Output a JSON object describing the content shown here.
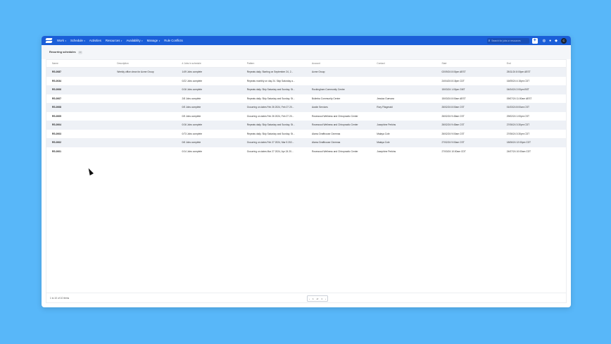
{
  "nav": {
    "items": [
      {
        "label": "Work",
        "dropdown": true
      },
      {
        "label": "Schedule",
        "dropdown": true
      },
      {
        "label": "Activities",
        "dropdown": false
      },
      {
        "label": "Resources",
        "dropdown": true
      },
      {
        "label": "Availability",
        "dropdown": true
      },
      {
        "label": "Manage",
        "dropdown": true
      },
      {
        "label": "Rule Conflicts",
        "dropdown": false
      }
    ],
    "search_placeholder": "Search for jobs or resources",
    "plus_label": "+",
    "avatar_initial": "C"
  },
  "page": {
    "title": "Recurring schedules",
    "count": "10"
  },
  "table": {
    "columns": [
      "Name",
      "Description",
      "# Jobs in schedule",
      "Pattern",
      "Account",
      "Contact",
      "Start",
      "End"
    ],
    "rows": [
      [
        "RS-0087",
        "Weekly office clean for Acme Group",
        "1/49 Jobs complete",
        "Repeats daily. Starting on September 24, 2...",
        "Acme Group",
        "",
        "02/09/24 8:00pm AEST",
        "25/11/24 8:00pm AEST"
      ],
      [
        "RS-0034",
        "",
        "0/22 Jobs complete",
        "Repeats monthly on day 24. Skip Saturday a...",
        "",
        "",
        "24/04/24 8:15pm CDT",
        "16/05/24 4:15pm CDT"
      ],
      [
        "RS-0006",
        "",
        "0/16 Jobs complete",
        "Repeats daily. Skip Saturday and Sunday. St...",
        "Rockingham Community Centre",
        "",
        "15/03/24 1:00pm GMT",
        "04/04/24 2:00pm BST"
      ],
      [
        "RS-0007",
        "",
        "2/8 Jobs complete",
        "Repeats daily. Skip Saturday and Sunday. St...",
        "Bulimba Community Centre",
        "Jessica Guevara",
        "15/03/24 8:00am AEST",
        "09/07/24 11:00am AEST"
      ],
      [
        "RS-0008",
        "",
        "0/5 Jobs complete",
        "Occurring on dates Feb 26 2024, Feb 27 20...",
        "Austin Services",
        "Rory Fitzgerald",
        "26/02/24 8:00am CST",
        "01/03/24 8:00am CST"
      ],
      [
        "RS-0005",
        "",
        "0/5 Jobs complete",
        "Occurring on dates Feb 26 2024, Feb 27 20...",
        "Rosewood Wellness and Chiropractic Center",
        "",
        "26/02/24 9:45am CST",
        "29/02/24 1:00pm CST"
      ],
      [
        "RS-0004",
        "",
        "0/16 Jobs complete",
        "Repeats daily. Skip Saturday and Sunday. St...",
        "Rosewood Wellness and Chiropractic Center",
        "Josephine Perkins",
        "26/02/24 9:45am CST",
        "27/06/24 3:30pm CDT"
      ],
      [
        "RS-0003",
        "",
        "0/73 Jobs complete",
        "Repeats daily. Skip Saturday and Sunday. St...",
        "Alamo Drafthouse Cinemas",
        "Malaya Cole",
        "26/02/24 9:00am CST",
        "27/06/24 3:30pm CDT"
      ],
      [
        "RS-0002",
        "",
        "0/6 Jobs complete",
        "Occurring on dates Feb 27 2024, Mar 5 202...",
        "Alamo Drafthouse Cinemas",
        "Malaya Cole",
        "27/02/24 9:00am CST",
        "18/06/24 12:00pm CDT"
      ],
      [
        "RS-0001",
        "",
        "0/14 Jobs complete",
        "Occurring on dates Mar 27 2024, Apr 24 20...",
        "Rosewood Wellness and Chiropractic Center",
        "Josephine Perkins",
        "27/03/24 10:00am CDT",
        "24/07/24 10:00am CDT"
      ]
    ]
  },
  "footer": {
    "summary": "1 to 10 of 10 items",
    "page_current": "1",
    "page_sep": "of",
    "page_total": "1",
    "prev": "‹",
    "next": "›"
  },
  "icons": {
    "search": "search-icon",
    "help": "help-icon",
    "chat": "chat-icon",
    "bell": "bell-icon"
  },
  "colors": {
    "topbar": "#1a5ed8",
    "background": "#58b7f9",
    "row_alt": "#eef1f6"
  }
}
